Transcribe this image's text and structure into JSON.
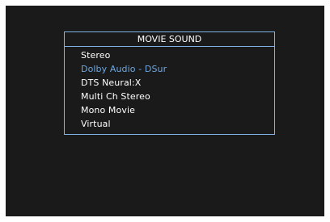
{
  "menu": {
    "title": "MOVIE SOUND",
    "items": [
      {
        "label": "Stereo",
        "selected": false
      },
      {
        "label": "Dolby Audio - DSur",
        "selected": true
      },
      {
        "label": "DTS Neural:X",
        "selected": false
      },
      {
        "label": "Multi Ch Stereo",
        "selected": false
      },
      {
        "label": "Mono Movie",
        "selected": false
      },
      {
        "label": "Virtual",
        "selected": false
      }
    ]
  },
  "colors": {
    "background": "#1a1a1a",
    "border": "#7fb4e6",
    "text": "#ffffff",
    "selected_text": "#6fa8e0"
  }
}
